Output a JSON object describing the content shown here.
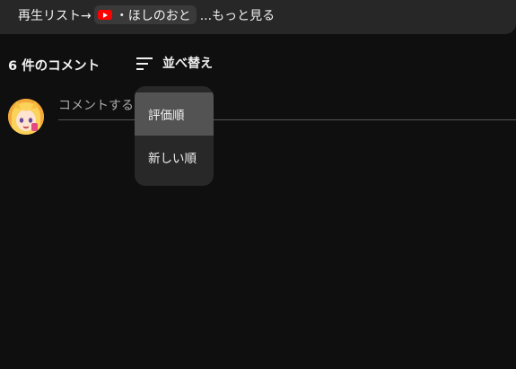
{
  "description": {
    "prefix": "再生リスト→",
    "chip_text": "・ほしのおと",
    "more_link": "...もっと見る"
  },
  "comments": {
    "count_label": "6 件のコメント",
    "sort_label": "並べ替え",
    "input_placeholder": "コメントする",
    "sort_menu": {
      "options": [
        "評価順",
        "新しい順"
      ],
      "selected": "評価順"
    }
  },
  "colors": {
    "background": "#0f0f0f",
    "menu_bg": "#282828",
    "menu_selected_bg": "#535353",
    "youtube_red": "#ff0000"
  }
}
